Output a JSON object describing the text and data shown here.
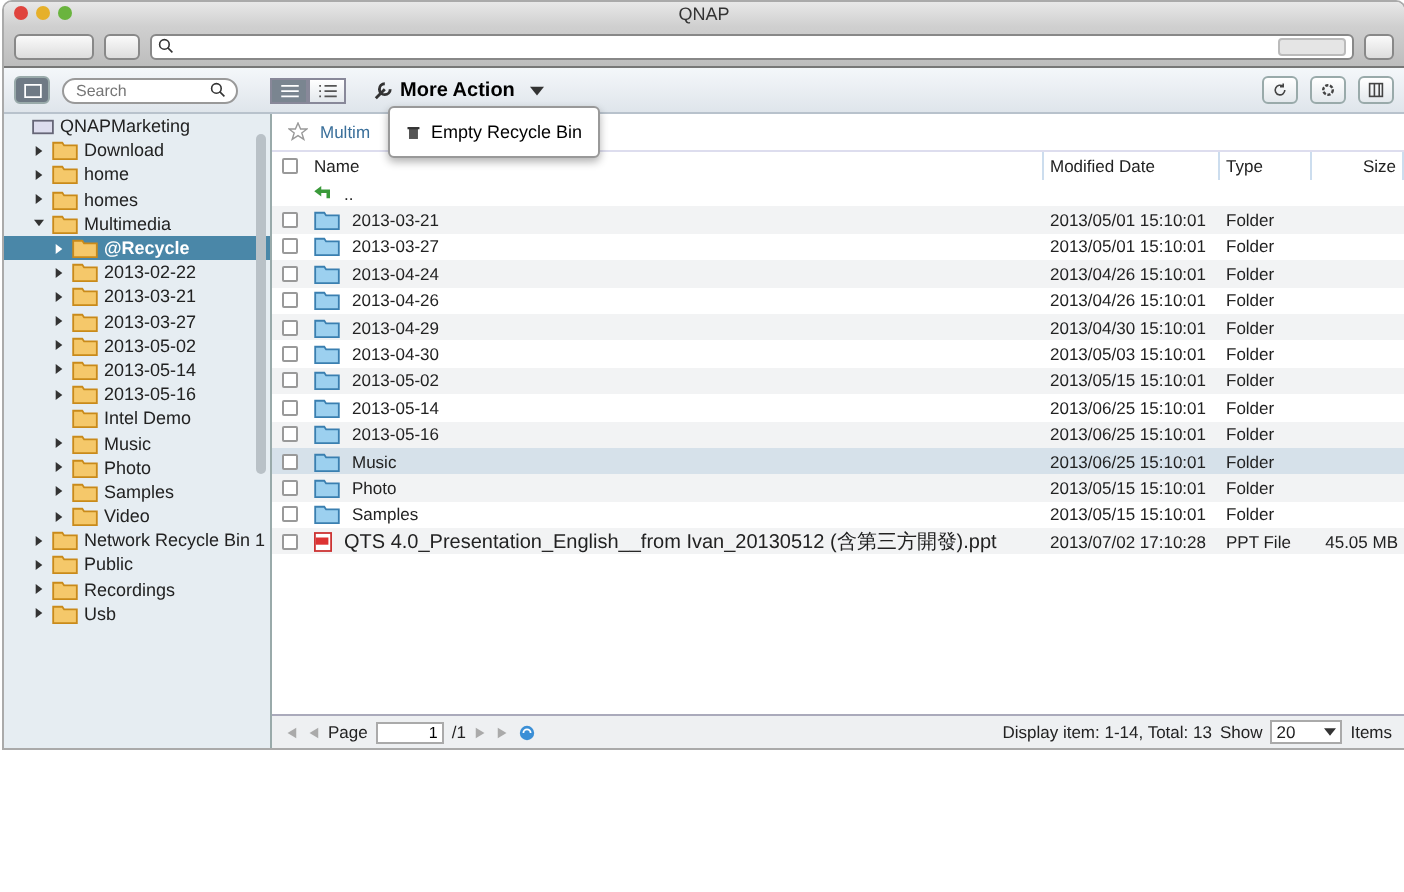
{
  "window": {
    "title": "QNAP"
  },
  "toolbar": {
    "search": {
      "placeholder": "Search"
    },
    "view_modes": [
      {
        "kind": "detail",
        "selected": true
      },
      {
        "kind": "list",
        "selected": false
      }
    ],
    "more_action": "More Action"
  },
  "menu": {
    "items": [
      {
        "label": "Empty Recycle Bin"
      }
    ]
  },
  "sidebar": {
    "items": [
      {
        "label": "QNAPMarketing",
        "kind": "nas",
        "expandable": false,
        "selected": false,
        "children": [
          {
            "label": "Download",
            "kind": "folder",
            "expandable": true,
            "expanded": false,
            "selected": false
          },
          {
            "label": "home",
            "kind": "folder",
            "expandable": true,
            "expanded": false,
            "selected": false
          },
          {
            "label": "homes",
            "kind": "folder",
            "expandable": true,
            "expanded": false,
            "selected": false
          },
          {
            "label": "Multimedia",
            "kind": "folder",
            "expandable": true,
            "expanded": true,
            "selected": false,
            "children": [
              {
                "label": "@Recycle",
                "kind": "folder",
                "expandable": true,
                "expanded": false,
                "selected": true
              },
              {
                "label": "2013-02-22",
                "kind": "folder",
                "expandable": true,
                "expanded": false,
                "selected": false
              },
              {
                "label": "2013-03-21",
                "kind": "folder",
                "expandable": true,
                "expanded": false,
                "selected": false
              },
              {
                "label": "2013-03-27",
                "kind": "folder",
                "expandable": true,
                "expanded": false,
                "selected": false
              },
              {
                "label": "2013-05-02",
                "kind": "folder",
                "expandable": true,
                "expanded": false,
                "selected": false
              },
              {
                "label": "2013-05-14",
                "kind": "folder",
                "expandable": true,
                "expanded": false,
                "selected": false
              },
              {
                "label": "2013-05-16",
                "kind": "folder",
                "expandable": true,
                "expanded": false,
                "selected": false
              },
              {
                "label": "Intel Demo",
                "kind": "folder",
                "expandable": false,
                "expanded": false,
                "selected": false
              },
              {
                "label": "Music",
                "kind": "folder",
                "expandable": true,
                "expanded": false,
                "selected": false
              },
              {
                "label": "Photo",
                "kind": "folder",
                "expandable": true,
                "expanded": false,
                "selected": false
              },
              {
                "label": "Samples",
                "kind": "folder",
                "expandable": true,
                "expanded": false,
                "selected": false
              },
              {
                "label": "Video",
                "kind": "folder",
                "expandable": true,
                "expanded": false,
                "selected": false
              }
            ]
          },
          {
            "label": "Network Recycle Bin 1",
            "kind": "folder",
            "expandable": true,
            "expanded": false,
            "selected": false
          },
          {
            "label": "Public",
            "kind": "folder",
            "expandable": true,
            "expanded": false,
            "selected": false
          },
          {
            "label": "Recordings",
            "kind": "folder",
            "expandable": true,
            "expanded": false,
            "selected": false
          },
          {
            "label": "Usb",
            "kind": "folder",
            "expandable": true,
            "expanded": false,
            "selected": false
          }
        ]
      }
    ]
  },
  "breadcrumb": "Multim",
  "table": {
    "select_all_checked": false,
    "columns": [
      "Name",
      "Modified Date",
      "Type",
      "Size"
    ],
    "parent": "..",
    "rows": [
      {
        "kind": "folder",
        "name": "2013-03-21",
        "date": "2013/05/01 15:10:01",
        "type": "Folder",
        "checked": false,
        "selected": false
      },
      {
        "kind": "folder",
        "name": "2013-03-27",
        "date": "2013/05/01 15:10:01",
        "type": "Folder",
        "checked": false,
        "selected": false
      },
      {
        "kind": "folder",
        "name": "2013-04-24",
        "date": "2013/04/26 15:10:01",
        "type": "Folder",
        "checked": false,
        "selected": false
      },
      {
        "kind": "folder",
        "name": "2013-04-26",
        "date": "2013/04/26 15:10:01",
        "type": "Folder",
        "checked": false,
        "selected": false
      },
      {
        "kind": "folder",
        "name": "2013-04-29",
        "date": "2013/04/30 15:10:01",
        "type": "Folder",
        "checked": false,
        "selected": false
      },
      {
        "kind": "folder",
        "name": "2013-04-30",
        "date": "2013/05/03 15:10:01",
        "type": "Folder",
        "checked": false,
        "selected": false
      },
      {
        "kind": "folder",
        "name": "2013-05-02",
        "date": "2013/05/15 15:10:01",
        "type": "Folder",
        "checked": false,
        "selected": false
      },
      {
        "kind": "folder",
        "name": "2013-05-14",
        "date": "2013/06/25 15:10:01",
        "type": "Folder",
        "checked": false,
        "selected": false
      },
      {
        "kind": "folder",
        "name": "2013-05-16",
        "date": "2013/06/25 15:10:01",
        "type": "Folder",
        "checked": false,
        "selected": false
      },
      {
        "kind": "folder",
        "name": "Music",
        "date": "2013/06/25 15:10:01",
        "type": "Folder",
        "checked": false,
        "selected": true
      },
      {
        "kind": "folder",
        "name": "Photo",
        "date": "2013/05/15 15:10:01",
        "type": "Folder",
        "checked": false,
        "selected": false
      },
      {
        "kind": "folder",
        "name": "Samples",
        "date": "2013/05/15 15:10:01",
        "type": "Folder",
        "checked": false,
        "selected": false
      },
      {
        "kind": "ppt",
        "name": "QTS 4.0_Presentation_English__from Ivan_20130512 (含第三方開發).ppt",
        "date": "2013/07/02 17:10:28",
        "type": "PPT File",
        "size": "45.05 MB",
        "checked": false,
        "selected": false
      }
    ]
  },
  "pager": {
    "page_label": "Page",
    "page": "1",
    "total_pages": "/1",
    "display": "Display item: 1-14, Total: 13",
    "show_label": "Show",
    "show": "20",
    "items_label": "Items"
  }
}
